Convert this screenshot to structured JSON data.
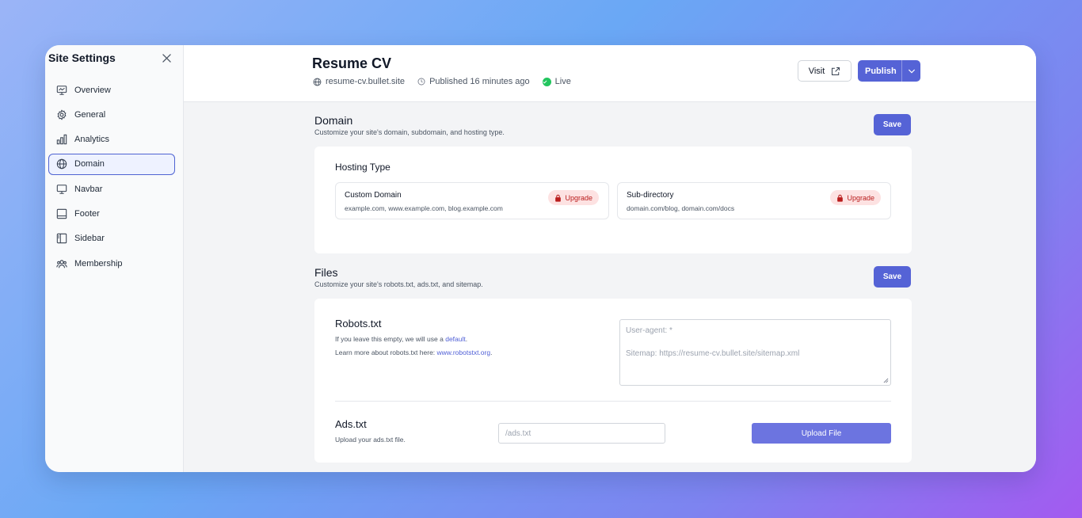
{
  "sidebar": {
    "title": "Site Settings",
    "items": [
      {
        "label": "Overview",
        "icon": "monitor-chart-icon"
      },
      {
        "label": "General",
        "icon": "gear-icon"
      },
      {
        "label": "Analytics",
        "icon": "bar-chart-icon"
      },
      {
        "label": "Domain",
        "icon": "globe-icon",
        "active": true
      },
      {
        "label": "Navbar",
        "icon": "monitor-icon"
      },
      {
        "label": "Footer",
        "icon": "footer-layout-icon"
      },
      {
        "label": "Sidebar",
        "icon": "sidebar-layout-icon"
      },
      {
        "label": "Membership",
        "icon": "users-icon"
      }
    ]
  },
  "header": {
    "title": "Resume CV",
    "domain": "resume-cv.bullet.site",
    "published": "Published 16 minutes ago",
    "status": "Live",
    "visit_label": "Visit",
    "publish_label": "Publish"
  },
  "domain_section": {
    "title": "Domain",
    "description": "Customize your site's domain, subdomain, and hosting type.",
    "save_label": "Save",
    "hosting_type_title": "Hosting Type",
    "options": [
      {
        "title": "Custom Domain",
        "subtitle": "example.com, www.example.com, blog.example.com",
        "badge": "Upgrade"
      },
      {
        "title": "Sub-directory",
        "subtitle": "domain.com/blog, domain.com/docs",
        "badge": "Upgrade"
      }
    ]
  },
  "files_section": {
    "title": "Files",
    "description": "Customize your site's robots.txt, ads.txt, and sitemap.",
    "save_label": "Save",
    "robots": {
      "title": "Robots.txt",
      "line1_prefix": "If you leave this empty, we will use a ",
      "line1_link": "default",
      "line1_suffix": ".",
      "line2_prefix": "Learn more about robots.txt here: ",
      "line2_link": "www.robotstxt.org",
      "line2_suffix": ".",
      "placeholder_line1": "User-agent: *",
      "placeholder_line2": "Sitemap: https://resume-cv.bullet.site/sitemap.xml"
    },
    "ads": {
      "title": "Ads.txt",
      "description": "Upload your ads.txt file.",
      "placeholder": "/ads.txt",
      "upload_label": "Upload File"
    }
  },
  "colors": {
    "accent": "#5563d6",
    "live": "#22c55e",
    "upgrade_bg": "#fde2e2",
    "upgrade_text": "#b91c1c"
  }
}
